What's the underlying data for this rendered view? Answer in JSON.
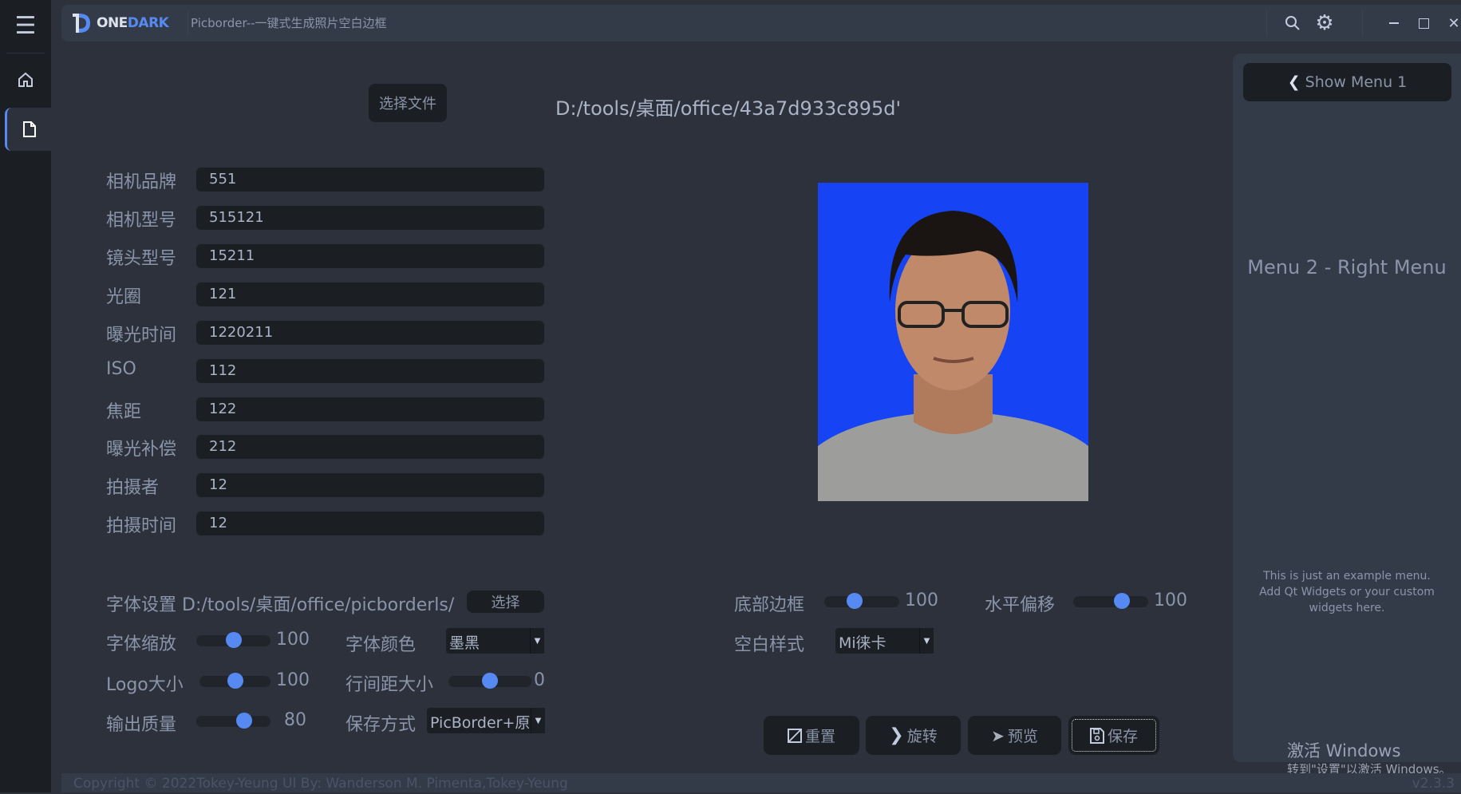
{
  "app": {
    "logo_text_one": "ONE",
    "logo_text_dark": "DARK",
    "title": "Picborder--一键式生成照片空白边框"
  },
  "left_menu": {
    "items": [
      {
        "icon": "menu-icon"
      },
      {
        "icon": "home-icon"
      },
      {
        "icon": "file-icon",
        "active": true
      }
    ]
  },
  "title_bar": {
    "icons": [
      "search-icon",
      "gear-icon",
      "minimize-icon",
      "maximize-icon",
      "close-icon"
    ]
  },
  "file": {
    "select_label": "选择文件",
    "path": "D:/tools/桌面/office/43a7d933c895d'"
  },
  "fields": [
    {
      "label": "相机品牌",
      "value": "551"
    },
    {
      "label": "相机型号",
      "value": "515121"
    },
    {
      "label": "镜头型号",
      "value": "15211"
    },
    {
      "label": "光圈",
      "value": "121"
    },
    {
      "label": "曝光时间",
      "value": "1220211"
    },
    {
      "label": "ISO",
      "value": "112"
    },
    {
      "label": "焦距",
      "value": "122"
    },
    {
      "label": "曝光补偿",
      "value": "212"
    },
    {
      "label": "拍摄者",
      "value": "12"
    },
    {
      "label": "拍摄时间",
      "value": "12"
    }
  ],
  "font_setting": {
    "label": "字体设置",
    "path": "D:/tools/桌面/office/picborderls/",
    "button": "选择"
  },
  "sliders": {
    "font_scale": {
      "label": "字体缩放",
      "value": "100",
      "fraction": 0.5
    },
    "logo_size": {
      "label": "Logo大小",
      "value": "100",
      "fraction": 0.5
    },
    "output_quality": {
      "label": "输出质量",
      "value": "80",
      "fraction": 0.65
    },
    "line_spacing": {
      "label": "行间距大小",
      "value": "0",
      "fraction": 0.5
    },
    "bottom_border": {
      "label": "底部边框",
      "value": "100",
      "fraction": 0.4
    },
    "horizontal_offset": {
      "label": "水平偏移",
      "value": "100",
      "fraction": 0.65
    }
  },
  "combos": {
    "font_color": {
      "label": "字体颜色",
      "value": "墨黑"
    },
    "save_mode": {
      "label": "保存方式",
      "value": "PicBorder+原"
    },
    "blank_style": {
      "label": "空白样式",
      "value": "Mi徕卡"
    }
  },
  "actions": {
    "reset": "重置",
    "rotate": "旋转",
    "preview": "预览",
    "save": "保存"
  },
  "right_menu": {
    "show_menu": "Show Menu 1",
    "title": "Menu 2 - Right Menu",
    "desc1": "This is just an example menu.",
    "desc2": "Add Qt Widgets or your custom",
    "desc3": "widgets here."
  },
  "watermark": {
    "line1": "激活 Windows",
    "line2": "转到\"设置\"以激活 Windows。"
  },
  "footer": {
    "credits": "Copyright © 2022Tokey-Yeung   UI By: Wanderson M. Pimenta,Tokey-Yeung",
    "version": "v2.3.3"
  },
  "colors": {
    "accent": "#568af2",
    "background": "#2c313c",
    "photo_background": "#1644f5"
  }
}
